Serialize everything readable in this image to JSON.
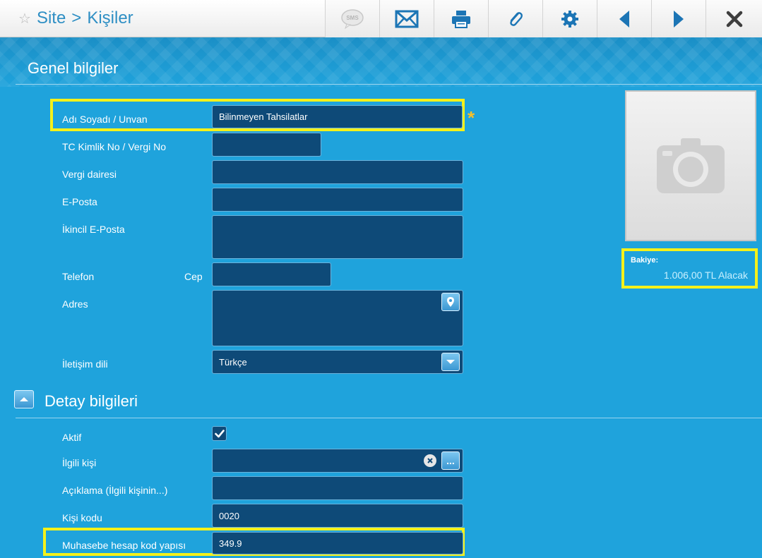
{
  "header": {
    "breadcrumb_site": "Site",
    "breadcrumb_sep": ">",
    "breadcrumb_page": "Kişiler",
    "sms_label": "SMS"
  },
  "general": {
    "title": "Genel bilgiler",
    "fields": {
      "name_label": "Adı Soyadı / Unvan",
      "name_value": "Bilinmeyen Tahsilatlar",
      "tc_label": "TC Kimlik No / Vergi No",
      "tax_office_label": "Vergi dairesi",
      "email_label": "E-Posta",
      "email2_label": "İkincil E-Posta",
      "phone_label": "Telefon",
      "mobile_label": "Cep",
      "address_label": "Adres",
      "language_label": "İletişim dili",
      "language_value": "Türkçe"
    },
    "required_mark": "*"
  },
  "balance": {
    "label": "Bakiye:",
    "value": "1.006,00 TL Alacak"
  },
  "detail": {
    "title": "Detay bilgileri",
    "fields": {
      "active_label": "Aktif",
      "related_label": "İlgili kişi",
      "related_btn": "...",
      "desc_label": "Açıklama (İlgili kişinin...)",
      "code_label": "Kişi kodu",
      "code_value": "0020",
      "account_label": "Muhasebe hesap kod yapısı",
      "account_value": "349.9"
    }
  },
  "colors": {
    "background": "#1fa3dc",
    "field_bg": "#0e4a78",
    "highlight": "#f5f11a",
    "link": "#2f8fc4"
  }
}
